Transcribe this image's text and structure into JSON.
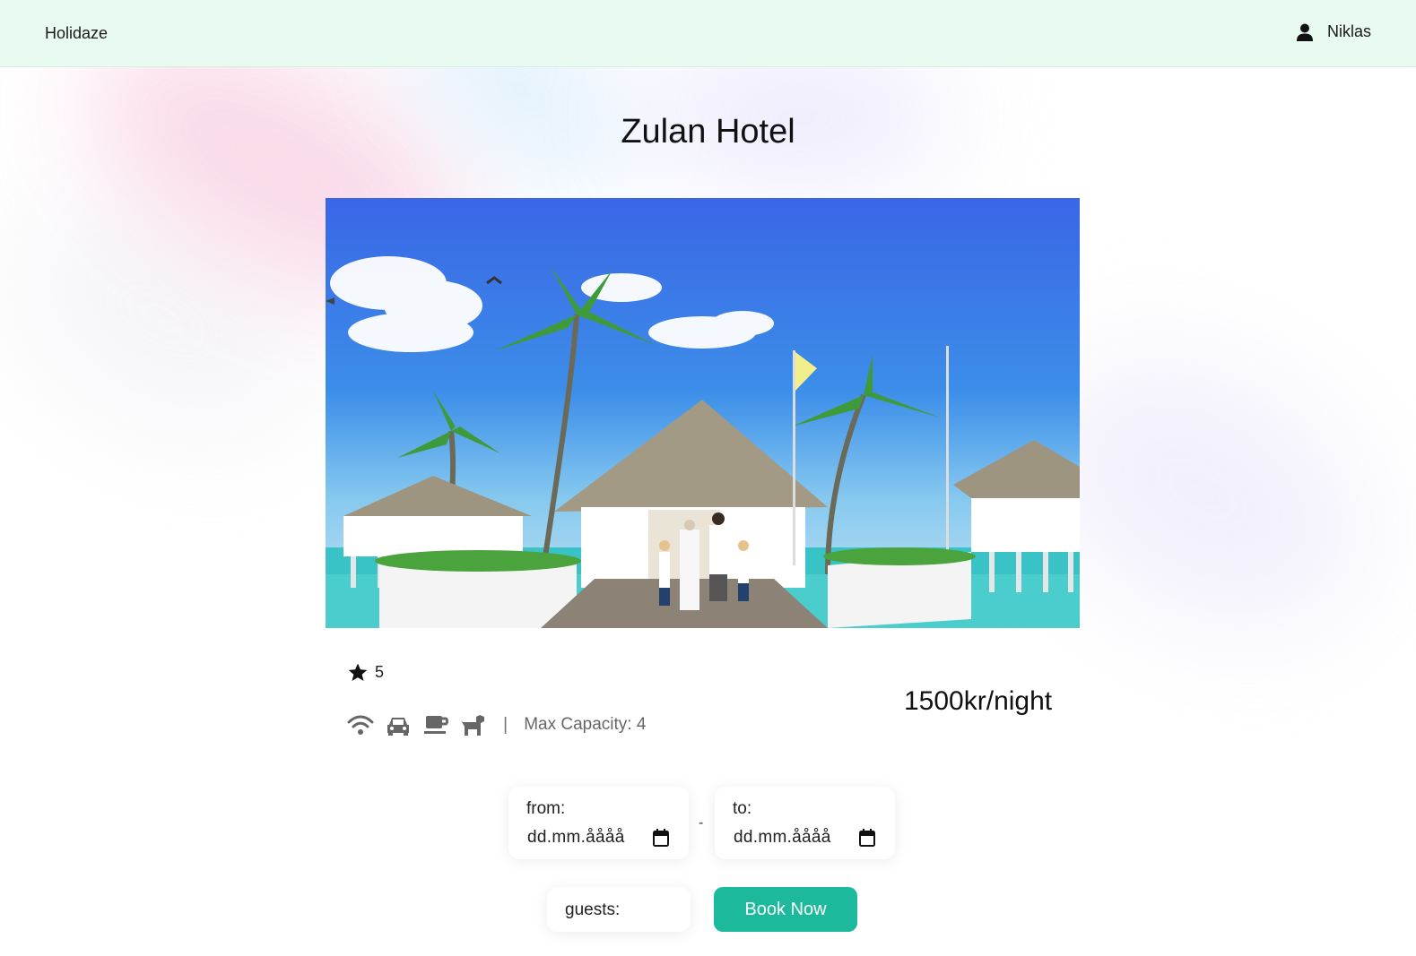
{
  "header": {
    "brand": "Holidaze",
    "user_name": "Niklas",
    "user_icon": "user-icon"
  },
  "venue": {
    "name": "Zulan Hotel",
    "image_alt": "Overwater bungalows with palm trees and a family on the pier",
    "rating": "5",
    "amenity_icons": [
      "wifi-icon",
      "car-icon",
      "coffee-icon",
      "dog-icon"
    ],
    "separator": "|",
    "capacity": "Max Capacity: 4",
    "price": "1500kr/night"
  },
  "booking": {
    "from_label": "from:",
    "from_value": "dd.mm.åååå",
    "to_label": "to:",
    "to_value": "dd.mm.åååå",
    "dash": "-",
    "guests_label": "guests:",
    "book_label": "Book Now"
  },
  "colors": {
    "header_bg": "#e9fbf1",
    "accent": "#1cb99d"
  }
}
